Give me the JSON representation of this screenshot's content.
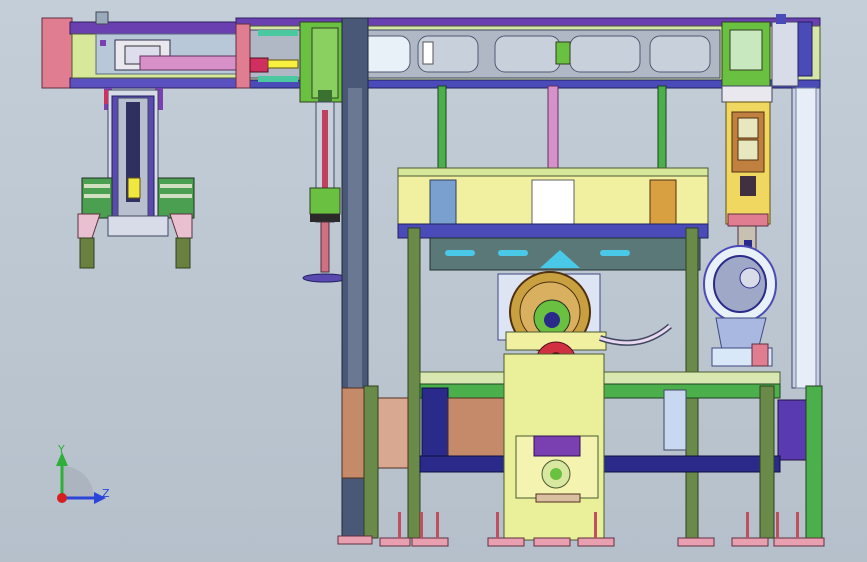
{
  "view": {
    "background_top": "#c4ced8",
    "background_bottom": "#b6c0cb"
  },
  "axes_triad": {
    "y_label": "Y",
    "z_label": "Z",
    "y_color": "#2fae3a",
    "z_color": "#2a45d8",
    "origin_color": "#d41f1f"
  },
  "palette": {
    "frame_blue": "#4a4ab8",
    "frame_purple": "#7a3fb0",
    "beam_yellow": "#d8e89a",
    "pink_block": "#e07d90",
    "green_column": "#4bb04b",
    "olive_post": "#6a8a4a",
    "brown_panel": "#c48a6a",
    "pale_yellow": "#f0f0a0",
    "blue_panel": "#7aa0d0",
    "dark_blue": "#2a2a8a",
    "cyan_slot": "#4ac8e8"
  }
}
